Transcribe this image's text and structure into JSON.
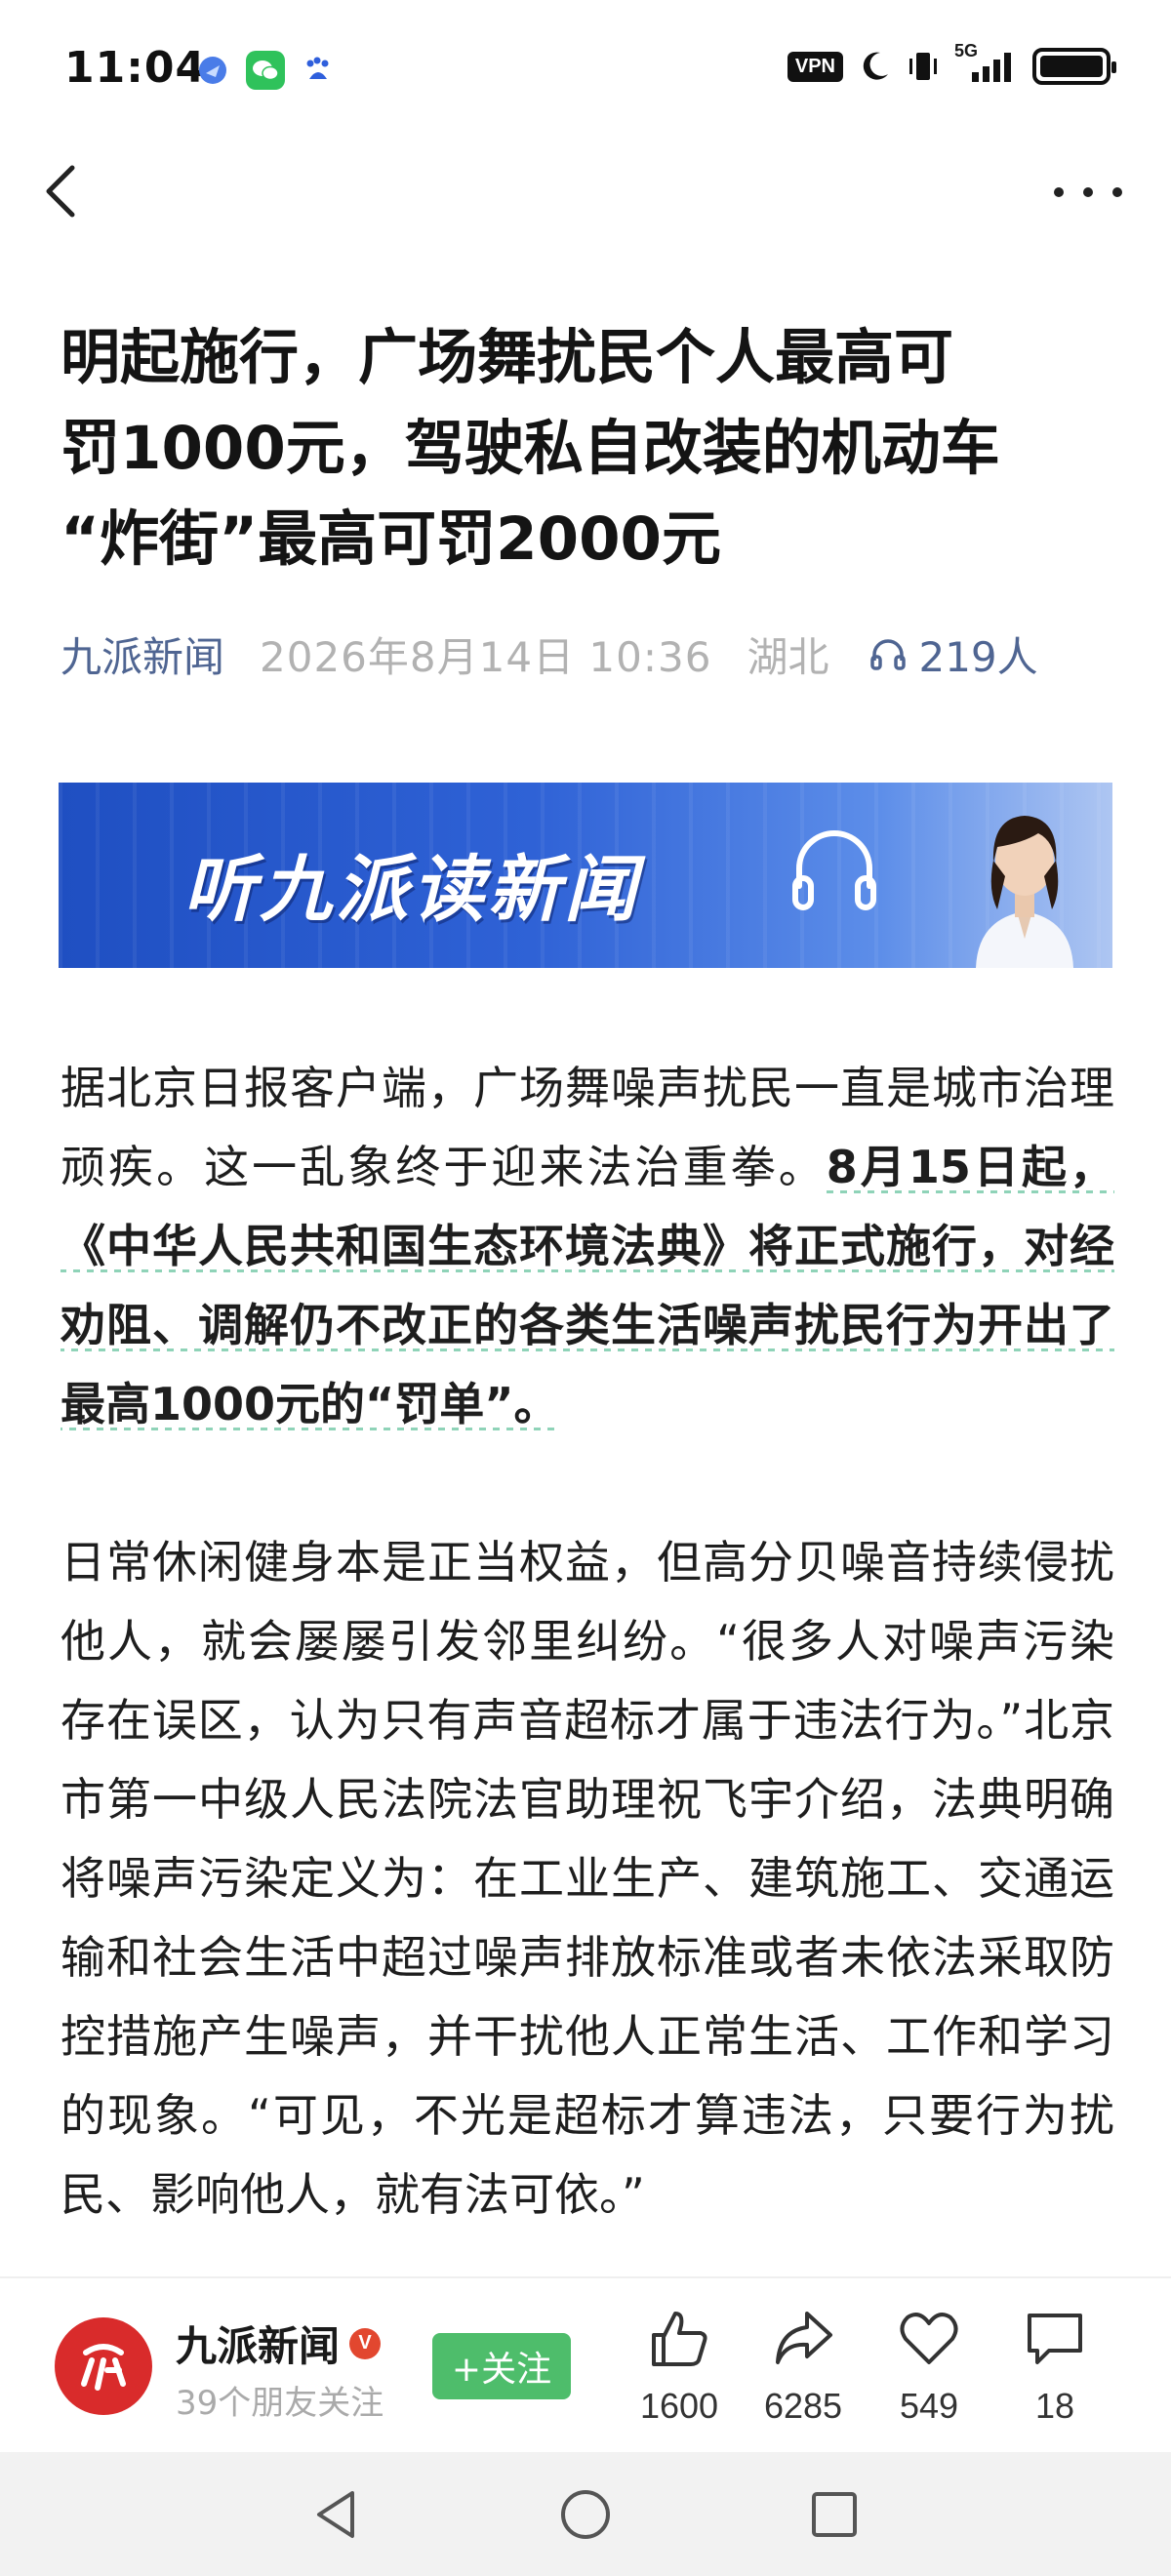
{
  "status_bar": {
    "time": "11:04",
    "app_icons": [
      "wallet-icon",
      "wechat-icon",
      "baidu-icon"
    ],
    "vpn_label": "VPN",
    "network_label": "5G",
    "right_icons": [
      "moon-icon",
      "vibrate-icon",
      "signal-icon",
      "battery-icon"
    ]
  },
  "nav": {
    "back_icon": "back-chevron-icon",
    "more_icon": "more-dots-icon"
  },
  "article": {
    "headline_lines": [
      "明起施行，广场舞扰民个人最高可",
      "罚1000元，驾驶私自改装的机动车",
      "“炸街”最高可罚2000元"
    ],
    "source": "九派新闻",
    "date": "2026年8月14日 10:36",
    "region": "湖北",
    "listens": "219人",
    "banner_title": "听九派读新闻",
    "para1_plain": "据北京日报客户端，广场舞噪声扰民一直是城市治理顽疾。这一乱象终于迎来法治重拳。",
    "para1_bold": "8月15日起，《中华人民共和国生态环境法典》将正式施行，对经劝阻、调解仍不改正的各类生活噪声扰民行为开出了最高1000元的“罚单”。",
    "para2": "日常休闲健身本是正当权益，但高分贝噪音持续侵扰他人，就会屡屡引发邻里纠纷。“很多人对噪声污染存在误区，认为只有声音超标才属于违法行为。”北京市第一中级人民法院法官助理祝飞宇介绍，法典明确将噪声污染定义为：在工业生产、建筑施工、交通运输和社会生活中超过噪声排放标准或者未依法采取防控措施产生噪声，并干扰他人正常生活、工作和学习的现象。“可见，不光是超标才算违法，只要行为扰民、影响他人，就有法可依。”"
  },
  "bottom_bar": {
    "author_name": "九派新闻",
    "verified_label": "V",
    "followers": "39个朋友关注",
    "follow_label": "+关注",
    "likes": "1600",
    "shares": "6285",
    "favorites": "549",
    "comments": "18"
  },
  "colors": {
    "source_link": "#4f6592",
    "follow_button": "#4ebd6b",
    "avatar": "#d92b2b",
    "banner": "#2f62d6",
    "highlight_underline": "#8fd3b8"
  }
}
